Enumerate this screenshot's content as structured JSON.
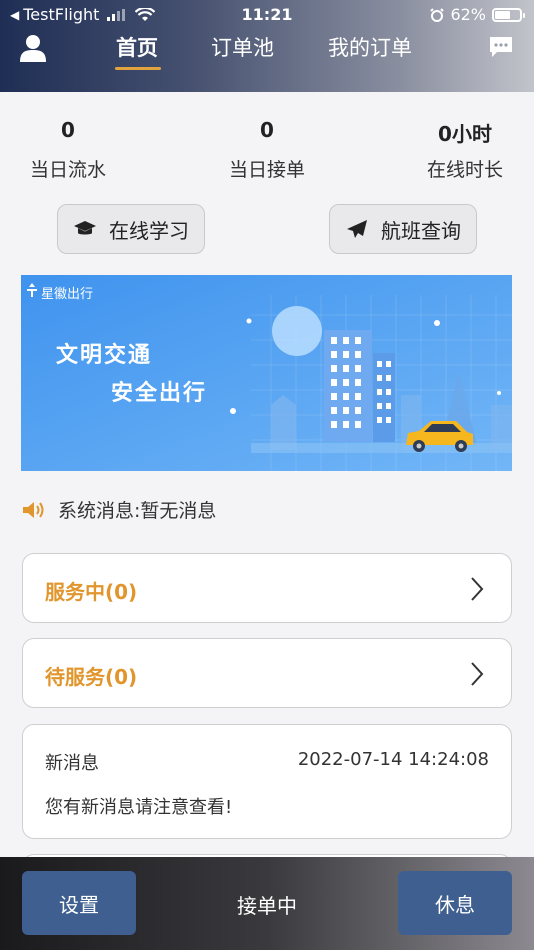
{
  "status_bar": {
    "back_app": "TestFlight",
    "time": "11:21",
    "battery_percent": "62%",
    "battery_level": 0.62
  },
  "nav": {
    "tabs": [
      {
        "label": "首页",
        "active": true
      },
      {
        "label": "订单池",
        "active": false
      },
      {
        "label": "我的订单",
        "active": false
      }
    ]
  },
  "stats": [
    {
      "value": "0",
      "label": "当日流水"
    },
    {
      "value": "0",
      "label": "当日接单"
    },
    {
      "value": "0小时",
      "label": "在线时长"
    }
  ],
  "actions": {
    "study_label": "在线学习",
    "flight_label": "航班查询"
  },
  "banner": {
    "logo_text": "星徽出行",
    "line1": "文明交通",
    "line2": "安全出行"
  },
  "system_message": "系统消息:暂无消息",
  "cards": {
    "in_service": "服务中(0)",
    "pending": "待服务(0)"
  },
  "news": {
    "title": "新消息",
    "time": "2022-07-14 14:24:08",
    "body": "您有新消息请注意查看!"
  },
  "bottom": {
    "settings_label": "设置",
    "status_label": "接单中",
    "rest_label": "休息"
  },
  "colors": {
    "accent_orange": "#e0962c",
    "button_blue": "#3e5f8f",
    "banner_blue": "#3e97ef"
  }
}
